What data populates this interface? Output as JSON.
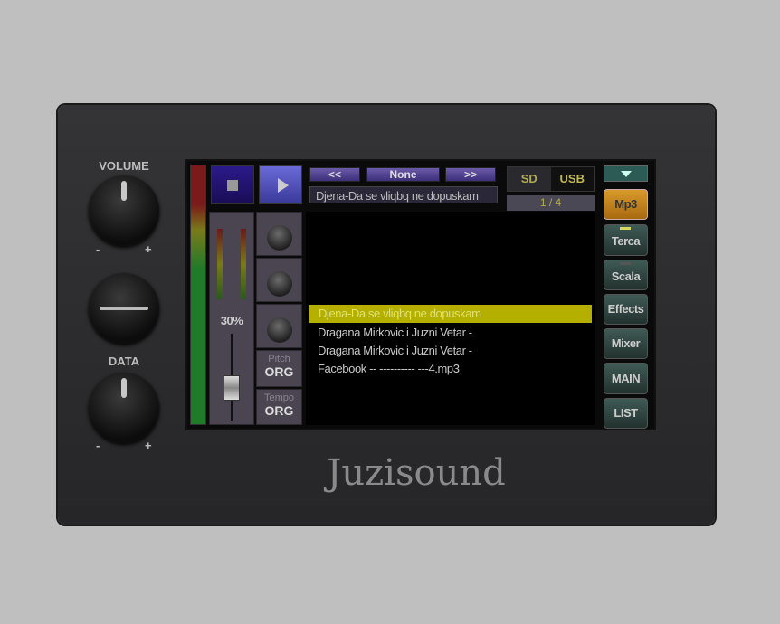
{
  "device": {
    "brand": "Juzisound",
    "volume_label": "VOLUME",
    "data_label": "DATA",
    "minus": "-",
    "plus": "+"
  },
  "transport": {
    "prev": "<<",
    "mode": "None",
    "next": ">>",
    "now_playing": "Djena-Da se vliqbq ne dopuskam"
  },
  "source": {
    "sd": "SD",
    "usb": "USB",
    "page": "1 / 4"
  },
  "mixer": {
    "volume_percent": "30%",
    "pitch_label": "Pitch",
    "pitch_value": "ORG",
    "tempo_label": "Tempo",
    "tempo_value": "ORG"
  },
  "playlist": [
    "Djena-Da se vliqbq ne dopuskam",
    "Dragana Mirkovic i Juzni Vetar -",
    "Dragana Mirkovic i Juzni Vetar -",
    "Facebook   -- ---------- ---4.mp3"
  ],
  "sidebar": {
    "items": [
      "Mp3",
      "Terca",
      "Scala",
      "Effects",
      "Mixer",
      "MAIN",
      "LIST"
    ]
  },
  "colors": {
    "highlight": "#b5b000",
    "active": "#d89a2a"
  }
}
